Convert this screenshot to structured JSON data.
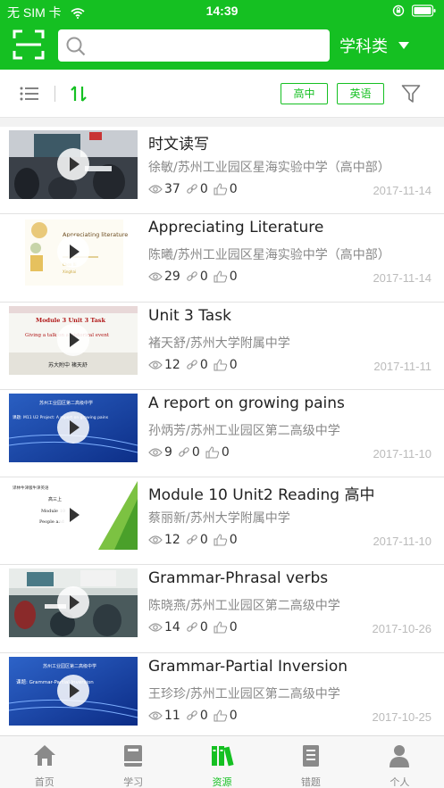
{
  "status_bar": {
    "carrier": "无 SIM 卡",
    "time": "14:39"
  },
  "header": {
    "search_placeholder": "",
    "subject_label": "学科类"
  },
  "filters": {
    "tag1": "高中",
    "tag2": "英语"
  },
  "items": [
    {
      "title": "时文读写",
      "author": "徐敏/苏州工业园区星海实验中学（高中部）",
      "views": "37",
      "links": "0",
      "likes": "0",
      "date": "2017-11-14"
    },
    {
      "title": "Appreciating Literature",
      "author": "陈曦/苏州工业园区星海实验中学（高中部）",
      "views": "29",
      "links": "0",
      "likes": "0",
      "date": "2017-11-14"
    },
    {
      "title": "Unit 3 Task",
      "author": "褚天舒/苏州大学附属中学",
      "views": "12",
      "links": "0",
      "likes": "0",
      "date": "2017-11-11"
    },
    {
      "title": "A report on growing pains",
      "author": "孙炳芳/苏州工业园区第二高级中学",
      "views": "9",
      "links": "0",
      "likes": "0",
      "date": "2017-11-10"
    },
    {
      "title": "Module 10 Unit2 Reading  高中",
      "author": "蔡丽新/苏州大学附属中学",
      "views": "12",
      "links": "0",
      "likes": "0",
      "date": "2017-11-10"
    },
    {
      "title": "Grammar-Phrasal verbs",
      "author": "陈晓燕/苏州工业园区第二高级中学",
      "views": "14",
      "links": "0",
      "likes": "0",
      "date": "2017-10-26"
    },
    {
      "title": "Grammar-Partial Inversion",
      "author": "王珍珍/苏州工业园区第二高级中学",
      "views": "11",
      "links": "0",
      "likes": "0",
      "date": "2017-10-25"
    }
  ],
  "thumbs": {
    "t2": "Appreciating literature",
    "t3a": "Module 3 Unit 3 Task",
    "t3b": "Giving a talk on a historical event",
    "t3c": "苏大附中 褚天舒",
    "t4a": "苏州工业园区第二高级中学",
    "t4b": "课题: M11 U2 Project: A report on growing pains",
    "t5a": "译林牛津版牛津英语",
    "t5b": "高三上",
    "t5c": "Module 10",
    "t5d": "People and",
    "t7a": "苏州工业园区第二高级中学",
    "t7b": "课题: Grammar-Partial Inversion"
  },
  "tabs": [
    {
      "label": "首页",
      "icon": "home-icon"
    },
    {
      "label": "学习",
      "icon": "book-icon"
    },
    {
      "label": "资源",
      "icon": "books-icon"
    },
    {
      "label": "错题",
      "icon": "notebook-icon"
    },
    {
      "label": "个人",
      "icon": "person-icon"
    }
  ],
  "colors": {
    "brand": "#15c022",
    "date": "#bbbbbb"
  }
}
